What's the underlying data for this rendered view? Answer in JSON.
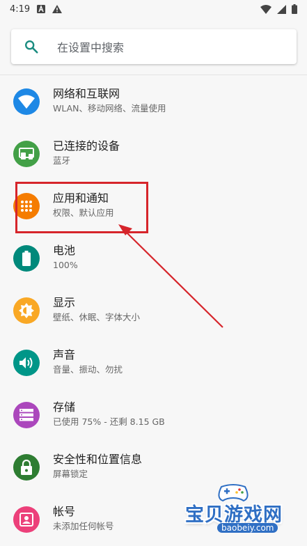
{
  "status_bar": {
    "time": "4:19"
  },
  "search": {
    "placeholder": "在设置中搜索"
  },
  "items": [
    {
      "title": "网络和互联网",
      "subtitle": "WLAN、移动网络、流量使用",
      "color": "#1e88e5",
      "icon": "wifi-icon"
    },
    {
      "title": "已连接的设备",
      "subtitle": "蓝牙",
      "color": "#43a047",
      "icon": "devices-icon"
    },
    {
      "title": "应用和通知",
      "subtitle": "权限、默认应用",
      "color": "#f57c00",
      "icon": "apps-grid-icon"
    },
    {
      "title": "电池",
      "subtitle": "100%",
      "color": "#00897b",
      "icon": "battery-icon"
    },
    {
      "title": "显示",
      "subtitle": "壁纸、休眠、字体大小",
      "color": "#f9a825",
      "icon": "brightness-icon"
    },
    {
      "title": "声音",
      "subtitle": "音量、振动、勿扰",
      "color": "#009688",
      "icon": "volume-icon"
    },
    {
      "title": "存储",
      "subtitle": "已使用 75% - 还剩 8.15 GB",
      "color": "#ab47bc",
      "icon": "storage-icon"
    },
    {
      "title": "安全性和位置信息",
      "subtitle": "屏幕锁定",
      "color": "#2e7d32",
      "icon": "lock-icon"
    },
    {
      "title": "帐号",
      "subtitle": "未添加任何帐号",
      "color": "#ec407a",
      "icon": "account-icon"
    }
  ],
  "watermark": {
    "title": "宝贝游戏网",
    "url": "baobeiy.com"
  }
}
